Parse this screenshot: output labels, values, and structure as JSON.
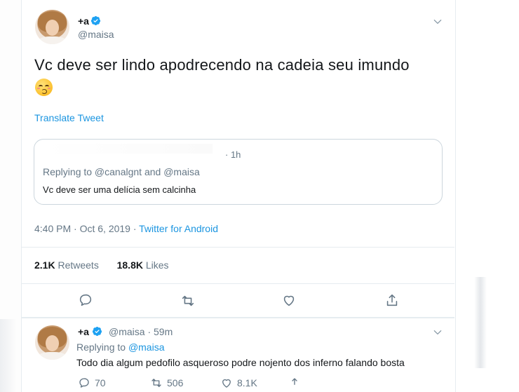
{
  "main_tweet": {
    "display_name": "+a",
    "handle": "@maisa",
    "text": "Vc deve ser lindo apodrecendo na cadeia seu imundo",
    "emoji": "kissing-face-emoji",
    "translate_label": "Translate Tweet",
    "quoted": {
      "time": "· 1h",
      "replying": "Replying to @canalgnt and @maisa",
      "text": "Vc deve ser uma delícia sem calcinha"
    },
    "timestamp": "4:40 PM · Oct 6, 2019 · ",
    "source": "Twitter for Android",
    "retweets_count": "2.1K",
    "retweets_label": " Retweets",
    "likes_count": "18.8K",
    "likes_label": " Likes"
  },
  "reply_tweet": {
    "display_name": "+a",
    "handle_time": "@maisa · 59m",
    "replying_prefix": "Replying to ",
    "replying_handle": "@maisa",
    "text": "Todo dia algum pedofilo asqueroso podre nojento dos inferno falando bosta",
    "reply_count": "70",
    "retweet_count": "506",
    "like_count": "8.1K"
  },
  "colors": {
    "link": "#1b95e0",
    "secondary_text": "#657786",
    "verified": "#1da1f2"
  }
}
